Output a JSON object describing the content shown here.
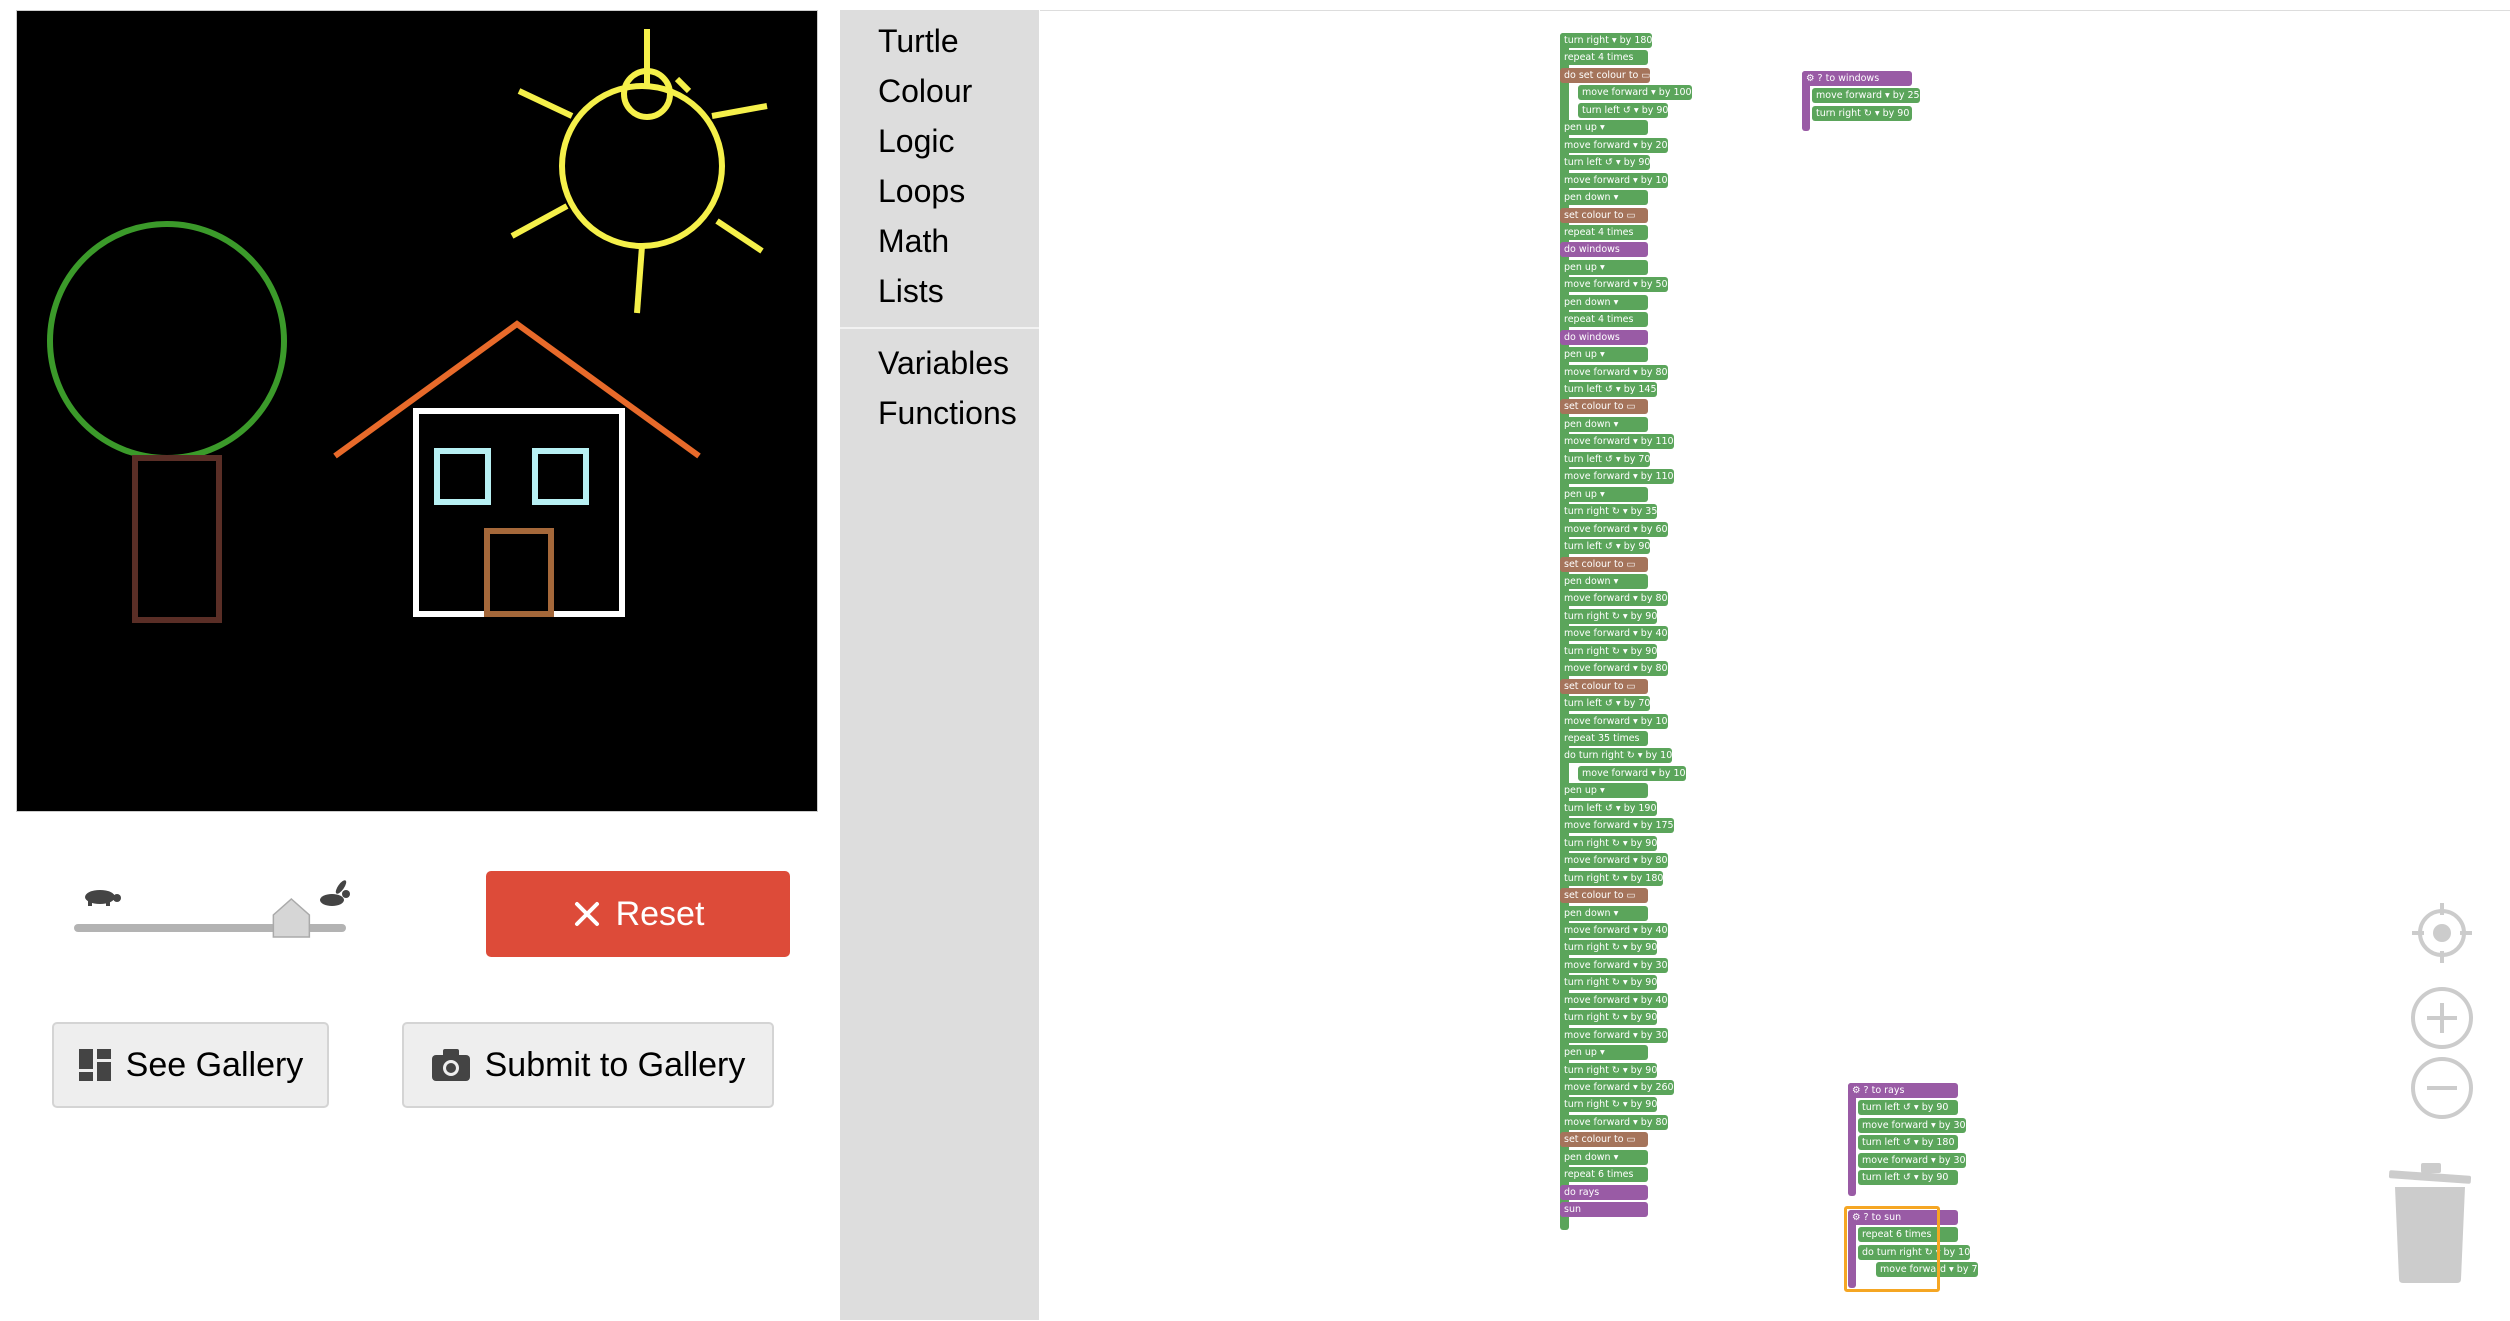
{
  "controls": {
    "reset_label": "Reset",
    "see_gallery_label": "See Gallery",
    "submit_gallery_label": "Submit to Gallery",
    "speed_value_fraction": 0.88,
    "speed_slow_icon": "turtle-icon",
    "speed_fast_icon": "rabbit-icon"
  },
  "toolbox": {
    "categories": [
      "Turtle",
      "Colour",
      "Logic",
      "Loops",
      "Math",
      "Lists"
    ],
    "categories2": [
      "Variables",
      "Functions"
    ]
  },
  "colors": {
    "turtle_block": "#5ba55b",
    "colour_block": "#a5745b",
    "procedure_block": "#995ba5",
    "reset": "#dd4b39"
  },
  "main_program": [
    {
      "cat": "g",
      "text": "turn right ▾ by 180"
    },
    {
      "cat": "g",
      "text": "repeat 4 times"
    },
    {
      "cat": "m",
      "text": "do   set colour to ▭",
      "indent": 0
    },
    {
      "cat": "g",
      "text": "move forward ▾ by 100",
      "indent": 1
    },
    {
      "cat": "g",
      "text": "turn left ↺ ▾ by 90",
      "indent": 1
    },
    {
      "cat": "g",
      "text": "pen up ▾"
    },
    {
      "cat": "g",
      "text": "move forward ▾ by 20"
    },
    {
      "cat": "g",
      "text": "turn left ↺ ▾ by 90"
    },
    {
      "cat": "g",
      "text": "move forward ▾ by 10"
    },
    {
      "cat": "g",
      "text": "pen down ▾"
    },
    {
      "cat": "m",
      "text": "set colour to ▭"
    },
    {
      "cat": "g",
      "text": "repeat 4 times"
    },
    {
      "cat": "p",
      "text": "do   windows"
    },
    {
      "cat": "g",
      "text": "pen up ▾"
    },
    {
      "cat": "g",
      "text": "move forward ▾ by 50"
    },
    {
      "cat": "g",
      "text": "pen down ▾"
    },
    {
      "cat": "g",
      "text": "repeat 4 times"
    },
    {
      "cat": "p",
      "text": "do   windows"
    },
    {
      "cat": "g",
      "text": "pen up ▾"
    },
    {
      "cat": "g",
      "text": "move forward ▾ by 80"
    },
    {
      "cat": "g",
      "text": "turn left ↺ ▾ by 145"
    },
    {
      "cat": "m",
      "text": "set colour to ▭"
    },
    {
      "cat": "g",
      "text": "pen down ▾"
    },
    {
      "cat": "g",
      "text": "move forward ▾ by 110"
    },
    {
      "cat": "g",
      "text": "turn left ↺ ▾ by 70"
    },
    {
      "cat": "g",
      "text": "move forward ▾ by 110"
    },
    {
      "cat": "g",
      "text": "pen up ▾"
    },
    {
      "cat": "g",
      "text": "turn right ↻ ▾ by 35"
    },
    {
      "cat": "g",
      "text": "move forward ▾ by 60"
    },
    {
      "cat": "g",
      "text": "turn left ↺ ▾ by 90"
    },
    {
      "cat": "m",
      "text": "set colour to ▭"
    },
    {
      "cat": "g",
      "text": "pen down ▾"
    },
    {
      "cat": "g",
      "text": "move forward ▾ by 80"
    },
    {
      "cat": "g",
      "text": "turn right ↻ ▾ by 90"
    },
    {
      "cat": "g",
      "text": "move forward ▾ by 40"
    },
    {
      "cat": "g",
      "text": "turn right ↻ ▾ by 90"
    },
    {
      "cat": "g",
      "text": "move forward ▾ by 80"
    },
    {
      "cat": "m",
      "text": "set colour to ▭"
    },
    {
      "cat": "g",
      "text": "turn left ↺ ▾ by 70"
    },
    {
      "cat": "g",
      "text": "move forward ▾ by 10"
    },
    {
      "cat": "g",
      "text": "repeat 35 times"
    },
    {
      "cat": "g",
      "text": "do   turn right ↻ ▾ by 10"
    },
    {
      "cat": "g",
      "text": "move forward ▾ by 10",
      "indent": 1
    },
    {
      "cat": "g",
      "text": "pen up ▾"
    },
    {
      "cat": "g",
      "text": "turn left ↺ ▾ by 190"
    },
    {
      "cat": "g",
      "text": "move forward ▾ by 175"
    },
    {
      "cat": "g",
      "text": "turn right ↻ ▾ by 90"
    },
    {
      "cat": "g",
      "text": "move forward ▾ by 80"
    },
    {
      "cat": "g",
      "text": "turn right ↻ ▾ by 180"
    },
    {
      "cat": "m",
      "text": "set colour to ▭"
    },
    {
      "cat": "g",
      "text": "pen down ▾"
    },
    {
      "cat": "g",
      "text": "move forward ▾ by 40"
    },
    {
      "cat": "g",
      "text": "turn right ↻ ▾ by 90"
    },
    {
      "cat": "g",
      "text": "move forward ▾ by 30"
    },
    {
      "cat": "g",
      "text": "turn right ↻ ▾ by 90"
    },
    {
      "cat": "g",
      "text": "move forward ▾ by 40"
    },
    {
      "cat": "g",
      "text": "turn right ↻ ▾ by 90"
    },
    {
      "cat": "g",
      "text": "move forward ▾ by 30"
    },
    {
      "cat": "g",
      "text": "pen up ▾"
    },
    {
      "cat": "g",
      "text": "turn right ↻ ▾ by 90"
    },
    {
      "cat": "g",
      "text": "move forward ▾ by 260"
    },
    {
      "cat": "g",
      "text": "turn right ↻ ▾ by 90"
    },
    {
      "cat": "g",
      "text": "move forward ▾ by 80"
    },
    {
      "cat": "m",
      "text": "set colour to ▭"
    },
    {
      "cat": "g",
      "text": "pen down ▾"
    },
    {
      "cat": "g",
      "text": "repeat 6 times"
    },
    {
      "cat": "p",
      "text": "do   rays"
    },
    {
      "cat": "p",
      "text": "sun",
      "indent": 0
    }
  ],
  "procedures": [
    {
      "name": "windows",
      "header": "⚙ ? to windows",
      "body": [
        "move forward ▾ by 25",
        "turn right ↻ ▾ by 90"
      ]
    },
    {
      "name": "rays",
      "header": "⚙ ? to rays",
      "body": [
        "turn left ↺ ▾ by 90",
        "move forward ▾ by 30",
        "turn left ↺ ▾ by 180",
        "move forward ▾ by 30",
        "turn left ↺ ▾ by 90"
      ]
    },
    {
      "name": "sun",
      "header": "⚙ ? to sun",
      "body": [
        "repeat 6 times",
        "do   turn right ↻ ▾ by 10",
        "move forward ▾ by 7"
      ]
    }
  ]
}
